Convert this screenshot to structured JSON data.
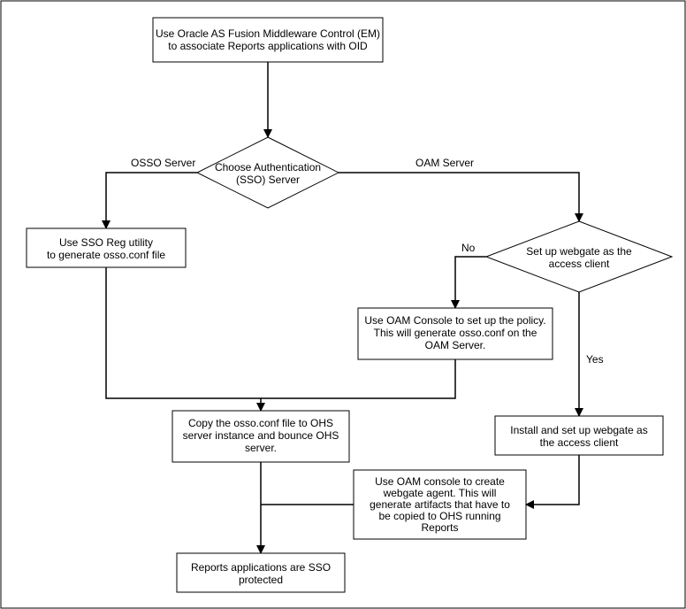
{
  "nodes": {
    "start": {
      "line1": "Use Oracle AS Fusion Middleware Control (EM)",
      "line2": "to associate Reports applications with OID"
    },
    "choose": {
      "line1": "Choose Authentication",
      "line2": "(SSO) Server"
    },
    "sso_reg": {
      "line1": "Use SSO Reg utility",
      "line2": "to generate osso.conf file"
    },
    "webgate_dec": {
      "line1": "Set up webgate as the",
      "line2": "access client"
    },
    "oam_console_policy": {
      "line1": "Use OAM Console to set up the policy.",
      "line2": "This will generate osso.conf on the",
      "line3": "OAM Server."
    },
    "copy_osso": {
      "line1": "Copy the osso.conf file to OHS",
      "line2": "server instance and bounce OHS",
      "line3": "server."
    },
    "install_webgate": {
      "line1": "Install and set up webgate as",
      "line2": "the access client"
    },
    "oam_webgate_agent": {
      "line1": "Use OAM console to create",
      "line2": "webgate agent. This will",
      "line3": "generate artifacts that have to",
      "line4": "be copied to OHS running",
      "line5": "Reports"
    },
    "final": {
      "line1": "Reports applications are SSO",
      "line2": "protected"
    }
  },
  "edge_labels": {
    "osso": "OSSO Server",
    "oam": "OAM Server",
    "no": "No",
    "yes": "Yes"
  }
}
